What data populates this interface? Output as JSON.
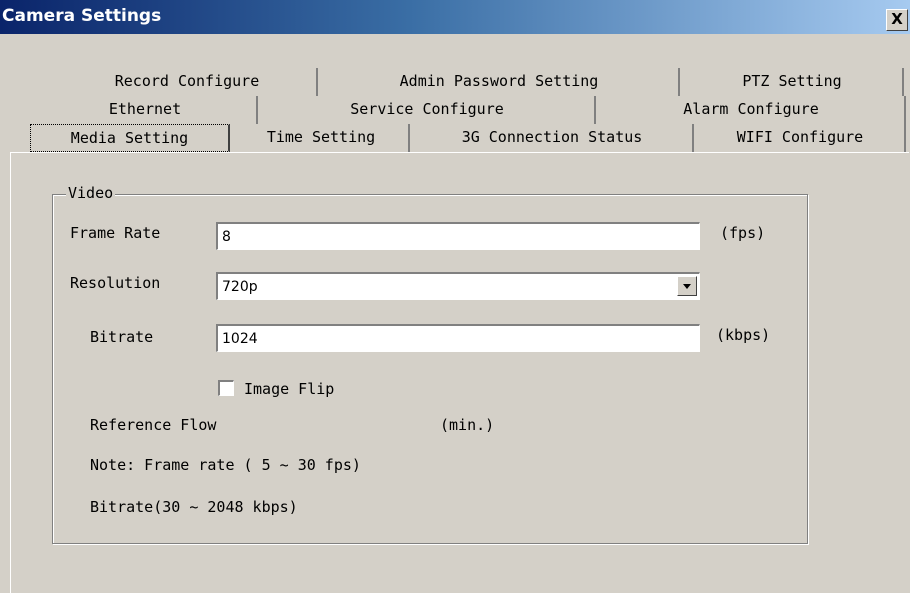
{
  "window": {
    "title": "Camera Settings",
    "close_label": "X"
  },
  "tabs": {
    "row1": [
      "Record Configure",
      "Admin Password Setting",
      "PTZ Setting"
    ],
    "row2": [
      "Ethernet",
      "Service Configure",
      "Alarm Configure"
    ],
    "row3": [
      "Media Setting",
      "Time Setting",
      "3G Connection Status",
      "WIFI Configure"
    ],
    "active": "Media Setting"
  },
  "video": {
    "group_label": "Video",
    "frame_rate_label": "Frame Rate",
    "frame_rate_value": "8",
    "frame_rate_unit": "(fps)",
    "resolution_label": "Resolution",
    "resolution_value": "720p",
    "bitrate_label": "Bitrate",
    "bitrate_value": "1024",
    "bitrate_unit": "(kbps)",
    "image_flip_label": "Image Flip",
    "image_flip_checked": false,
    "reference_flow_label": "Reference Flow",
    "reference_flow_unit": "(min.)",
    "note_frame_rate": "Note: Frame rate ( 5 ~ 30 fps)",
    "note_bitrate": "Bitrate(30 ~ 2048 kbps)"
  }
}
